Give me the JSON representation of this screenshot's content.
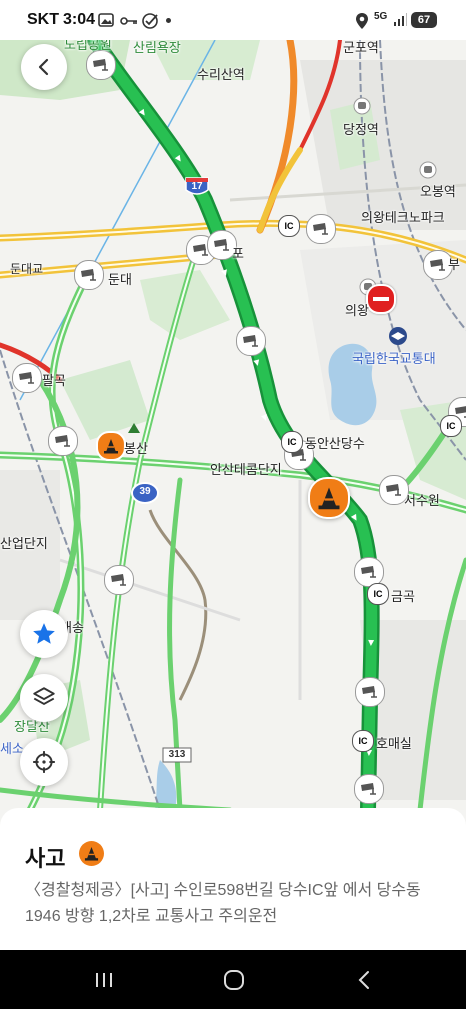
{
  "status_bar": {
    "carrier": "SKT",
    "time": "3:04",
    "network": "5G",
    "battery": "67"
  },
  "map": {
    "labels": {
      "top_park": "도립공원",
      "sanrim": "산림욕장",
      "suri_station": "수리산역",
      "gunpo_station": "군포역",
      "dangjeong_station": "당정역",
      "obong_station": "오봉역",
      "uiwang_techno": "의왕테크노파크",
      "dundae_bridge": "둔대교",
      "dundae": "둔대",
      "uiwang": "의왕",
      "transport_univ": "국립한국교통대",
      "palgok": "팔곡",
      "bongsan": "봉산",
      "dongansan_dangsu": "동안산당수",
      "ansan_telecom": "안산테콤단지",
      "seosuwon": "서수원",
      "industrial_complex": "산업단지",
      "geumgok": "금곡",
      "maesong": "매송",
      "jangdalsan": "장달산",
      "homaesil": "호매실",
      "left_edge": "세소",
      "ic_label": "IC",
      "route_17": "17",
      "route_39": "39",
      "route_313": "313",
      "to_label": "포",
      "bu_label": "부"
    }
  },
  "controls": {
    "back": "back",
    "favorite": "star",
    "layers": "layers",
    "locate": "crosshair"
  },
  "panel": {
    "title": "사고",
    "description": "〈경찰청제공〉[사고] 수인로598번길 당수IC앞 에서 당수동1946 방향 1,2차로 교통사고 주의운전"
  },
  "colors": {
    "highway_green": "#1fae48",
    "road_yellow": "#f2c33a",
    "road_orange": "#f08a2a",
    "road_red": "#e0342b",
    "accident_orange": "#f07d16",
    "fab_blue": "#1a73e8"
  }
}
